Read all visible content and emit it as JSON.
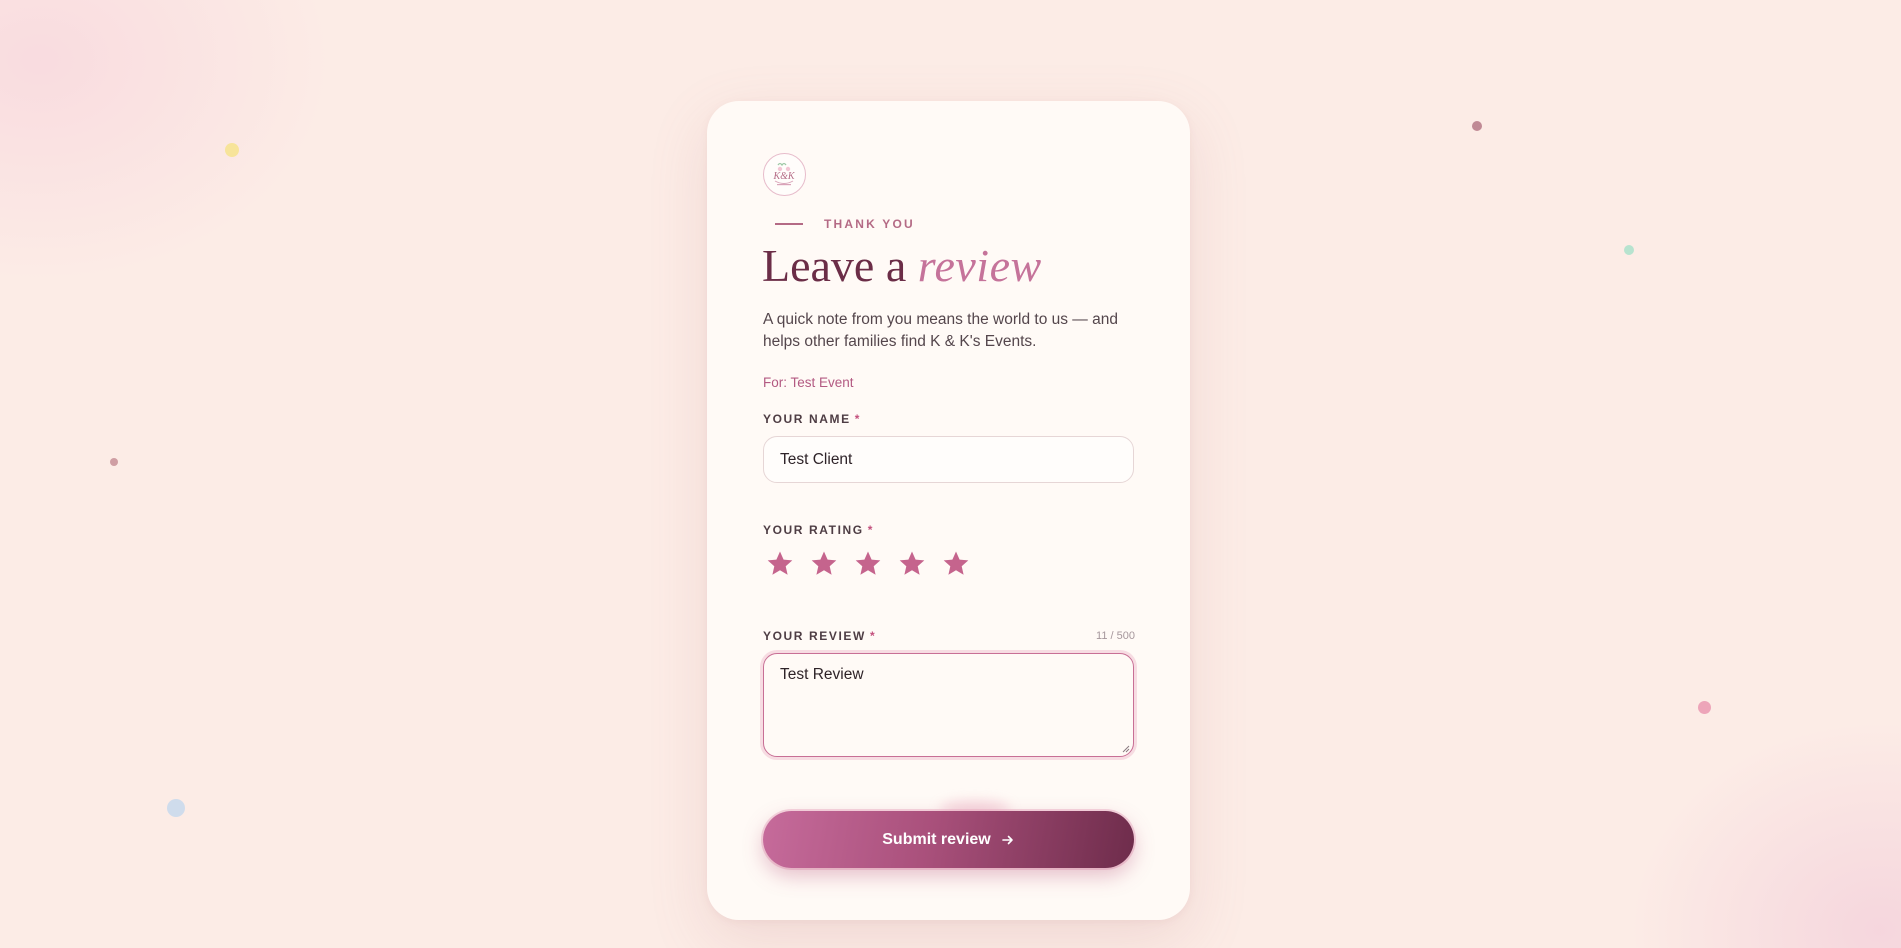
{
  "form": {
    "eyebrow": "THANK YOU",
    "title_main": "Leave a",
    "title_accent": "review",
    "subtitle": "A quick note from you means the world to us — and helps other families find K & K's Events.",
    "for_event": "For: Test Event",
    "name": {
      "label": "YOUR NAME",
      "required_mark": "*",
      "value": "Test Client"
    },
    "rating": {
      "label": "YOUR RATING",
      "required_mark": "*",
      "value": 5,
      "max": 5
    },
    "review": {
      "label": "YOUR REVIEW",
      "required_mark": "*",
      "counter": "11 / 500",
      "value": "Test Review"
    },
    "submit_label": "Submit review"
  },
  "icons": {
    "logo": "k-and-k-events-logo",
    "star": "star-icon",
    "submit_arrow": "arrow-right-icon"
  },
  "colors": {
    "background": "#fcece6",
    "card": "#fffaf6",
    "accent": "#b46a85",
    "title": "#6b2d47",
    "star": "#c5648d",
    "button_start": "#c66b9b",
    "button_end": "#6e2c4b"
  }
}
